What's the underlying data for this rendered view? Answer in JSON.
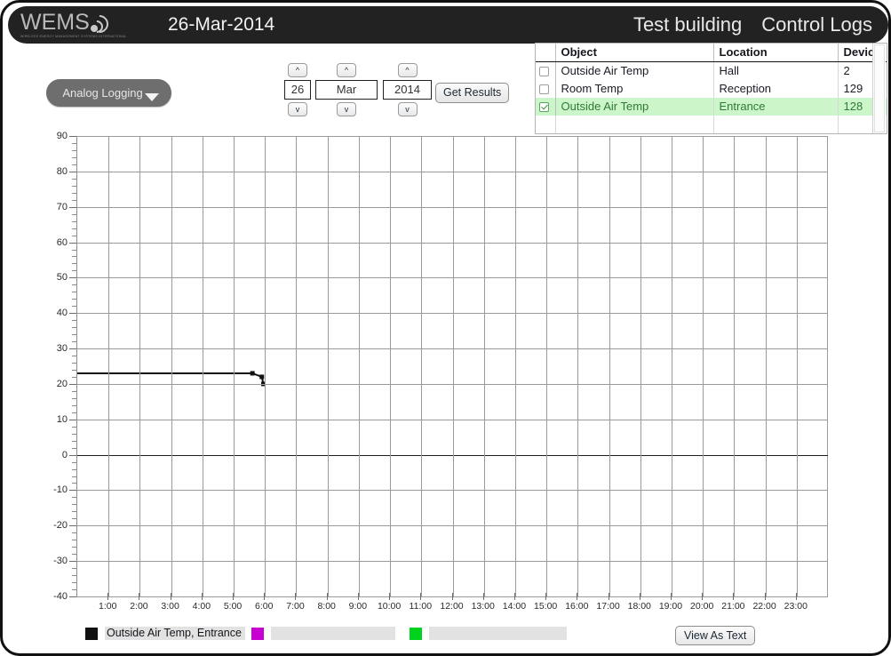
{
  "header": {
    "logo_word": "WEMS",
    "logo_subtitle": "WIRELESS ENERGY MANAGEMENT SYSTEMS INTERNATIONAL",
    "logo_icon": "wireless-signal-icon",
    "date": "26-Mar-2014",
    "building": "Test building",
    "section": "Control Logs"
  },
  "toolbar": {
    "mode_label": "Analog Logging",
    "mode_caret_icon": "caret-down-icon",
    "get_results_label": "Get Results",
    "spinners": [
      {
        "name": "day",
        "value": "26",
        "up": "^",
        "down": "v"
      },
      {
        "name": "month",
        "value": "Mar",
        "up": "^",
        "down": "v"
      },
      {
        "name": "year",
        "value": "2014",
        "up": "^",
        "down": "v"
      }
    ]
  },
  "object_table": {
    "columns": [
      "",
      "Object",
      "Location",
      "Device"
    ],
    "rows": [
      {
        "checked": false,
        "object": "Outside Air Temp",
        "location": "Hall",
        "device": "2"
      },
      {
        "checked": false,
        "object": "Room Temp",
        "location": "Reception",
        "device": "129"
      },
      {
        "checked": true,
        "object": "Outside Air Temp",
        "location": "Entrance",
        "device": "128"
      }
    ],
    "selected_row_color": "#ccf5ca",
    "selected_text_color": "#2f7a34"
  },
  "chart_data": {
    "type": "line",
    "title": "",
    "xlabel": "",
    "ylabel": "",
    "ylim": [
      -40,
      90
    ],
    "y_major_step": 10,
    "y_minor_step": 2,
    "ytick_labels": [
      "90",
      "80",
      "70",
      "60",
      "50",
      "40",
      "30",
      "20",
      "10",
      "0",
      "-10",
      "-20",
      "-30",
      "-40"
    ],
    "xlim": [
      0,
      24
    ],
    "xtick_labels": [
      "1:00",
      "2:00",
      "3:00",
      "4:00",
      "5:00",
      "6:00",
      "7:00",
      "8:00",
      "9:00",
      "10:00",
      "11:00",
      "12:00",
      "13:00",
      "14:00",
      "15:00",
      "16:00",
      "17:00",
      "18:00",
      "19:00",
      "20:00",
      "21:00",
      "22:00",
      "23:00"
    ],
    "grid": true,
    "legend_position": "bottom",
    "series": [
      {
        "name": "Outside Air Temp, Entrance",
        "color": "#111111",
        "points": [
          {
            "x": 0.0,
            "y": 23
          },
          {
            "x": 5.6,
            "y": 23
          },
          {
            "x": 5.9,
            "y": 22
          },
          {
            "x": 5.95,
            "y": 20
          }
        ]
      }
    ]
  },
  "legend": {
    "items": [
      {
        "color": "#111111",
        "label": "Outside Air Temp, Entrance"
      },
      {
        "color": "#c800d2",
        "label": ""
      },
      {
        "color": "#00d21e",
        "label": ""
      }
    ]
  },
  "footer": {
    "view_as_text_label": "View As Text"
  }
}
